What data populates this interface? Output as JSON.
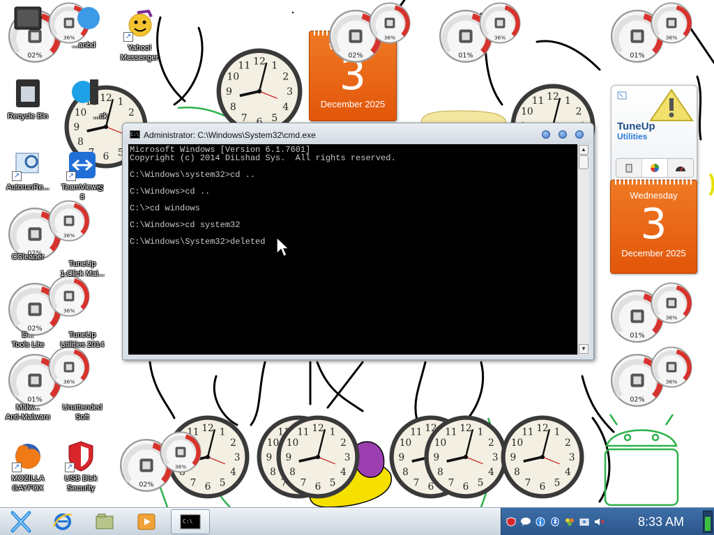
{
  "desktop": {
    "icons": [
      {
        "label": "",
        "icon": "monitor-icon"
      },
      {
        "label": "...anbd",
        "icon": "app-icon"
      },
      {
        "label": "Yahoo!\nMessenger",
        "icon": "yahoo-messenger-icon"
      },
      {
        "label": "Recycle Bin",
        "icon": "recycle-bin-icon"
      },
      {
        "label": "...ck",
        "icon": "app-icon"
      },
      {
        "label": "AutorunRe...",
        "icon": "autorun-icon"
      },
      {
        "label": "TeamViewer\n8",
        "icon": "teamviewer-icon"
      },
      {
        "label": "S",
        "icon": "app-icon"
      },
      {
        "label": "CCleaner",
        "icon": "ccleaner-icon"
      },
      {
        "label": "TuneUp\n1-Click Mai...",
        "icon": "tuneup-icon"
      },
      {
        "label": "D...\nTools Lite",
        "icon": "daemon-tools-icon"
      },
      {
        "label": "TuneUp\nUtilities 2014",
        "icon": "tuneup-utilities-icon"
      },
      {
        "label": "Malw...\nAnti-Malware",
        "icon": "malwarebytes-icon"
      },
      {
        "label": "Unattended\nSoft",
        "icon": "unattended-icon"
      },
      {
        "label": "MOZILLA\nGAYFOX",
        "icon": "firefox-icon"
      },
      {
        "label": "USB Disk\nSecurity",
        "icon": "usb-disk-security-icon"
      }
    ],
    "gauges": [
      {
        "cpu": "02%",
        "mem": "36%"
      },
      {
        "cpu": "01%",
        "mem": "36%"
      },
      {
        "cpu": "01%",
        "mem": "36%"
      },
      {
        "cpu": "02%",
        "mem": "36%"
      },
      {
        "cpu": "02%",
        "mem": "36%"
      },
      {
        "cpu": "01%",
        "mem": "36%"
      },
      {
        "cpu": "01%",
        "mem": "36%"
      },
      {
        "cpu": "02%",
        "mem": "36%"
      },
      {
        "cpu": "02%",
        "mem": "36%"
      },
      {
        "cpu": "02%",
        "mem": "36%"
      },
      {
        "cpu": "02%",
        "mem": "36%"
      }
    ],
    "clock_numerals": [
      "12",
      "1",
      "2",
      "3",
      "4",
      "5",
      "6",
      "7",
      "8",
      "9",
      "10",
      "11"
    ],
    "calendar": {
      "weekday": "Wednesday",
      "day": "3",
      "month_year": "December 2025"
    },
    "tuneup_gadget": {
      "brand": "TuneUp",
      "sub": "Utilities"
    }
  },
  "cmd": {
    "title": "Administrator: C:\\Windows\\System32\\cmd.exe",
    "lines": [
      "Microsoft Windows [Version 6.1.7601]",
      "Copyright (c) 2014 DiLshad Sys.  All rights reserved.",
      "",
      "C:\\Windows\\system32>cd ..",
      "",
      "C:\\Windows>cd ..",
      "",
      "C:\\>cd windows",
      "",
      "C:\\Windows>cd system32",
      "",
      "C:\\Windows\\System32>deleted"
    ]
  },
  "taskbar": {
    "items": [
      {
        "name": "start-button",
        "icon": "start-x-icon"
      },
      {
        "name": "internet-explorer-button",
        "icon": "internet-explorer-icon"
      },
      {
        "name": "explorer-button",
        "icon": "folder-icon"
      },
      {
        "name": "media-player-button",
        "icon": "media-player-icon"
      },
      {
        "name": "cmd-taskbar-button",
        "icon": "cmd-icon"
      }
    ],
    "tray_icons": [
      "usb-security-icon",
      "chat-icon",
      "info-icon",
      "bluetooth-icon",
      "network-share-icon",
      "sync-icon",
      "volume-muted-icon"
    ],
    "clock": "8:33 AM"
  },
  "colors": {
    "calendar_orange": "#e8640f",
    "tray_blue": "#2f5d93",
    "console_bg": "#000000",
    "console_fg": "#c8c8c8"
  }
}
